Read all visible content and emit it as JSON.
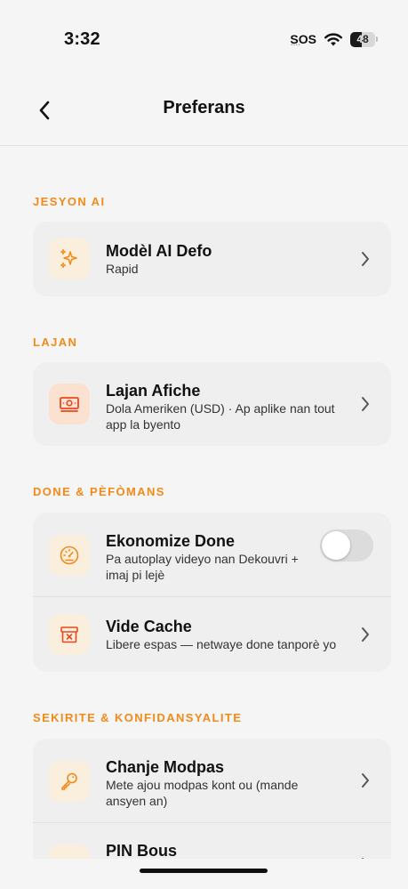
{
  "status_bar": {
    "time": "3:32",
    "sos": "SOS",
    "battery_level": "48",
    "battery_fraction": 0.48,
    "icons": [
      "wifi-icon",
      "battery-icon"
    ]
  },
  "nav": {
    "back_icon": "chevron-left-icon",
    "title": "Preferans"
  },
  "colors": {
    "accent": "#f28a18",
    "background": "#f5f5f5",
    "card": "#efefef",
    "icon_tile": "#faeedd",
    "icon_tile_strong": "#fbe1cf",
    "toggle_off": "#dcdcdc"
  },
  "sections": [
    {
      "header": "JESYON AI",
      "rows": [
        {
          "icon": "sparkles-icon",
          "title": "Modèl AI Defo",
          "subtitle": "Rapid",
          "control": "chevron"
        }
      ]
    },
    {
      "header": "LAJAN",
      "rows": [
        {
          "icon": "banknote-icon",
          "title": "Lajan Afiche",
          "subtitle": "Dola Ameriken (USD) · Ap aplike nan tout app la byento",
          "control": "chevron"
        }
      ]
    },
    {
      "header": "DONE & PÈFÒMANS",
      "rows": [
        {
          "icon": "gauge-icon",
          "title": "Ekonomize Done",
          "subtitle": "Pa autoplay videyo nan Dekouvri + imaj pi lejè",
          "control": "toggle",
          "toggle_on": false
        },
        {
          "icon": "archive-x-icon",
          "title": "Vide Cache",
          "subtitle": "Libere espas — netwaye done tanporè yo",
          "control": "chevron"
        }
      ]
    },
    {
      "header": "SEKIRITE & KONFIDANSYALITE",
      "rows": [
        {
          "icon": "key-icon",
          "title": "Chanje Modpas",
          "subtitle": "Mete ajou modpas kont ou (mande ansyen an)",
          "control": "chevron"
        },
        {
          "icon": "pin-icon",
          "title": "PIN Bous",
          "subtitle": "",
          "control": "chevron"
        }
      ]
    }
  ]
}
